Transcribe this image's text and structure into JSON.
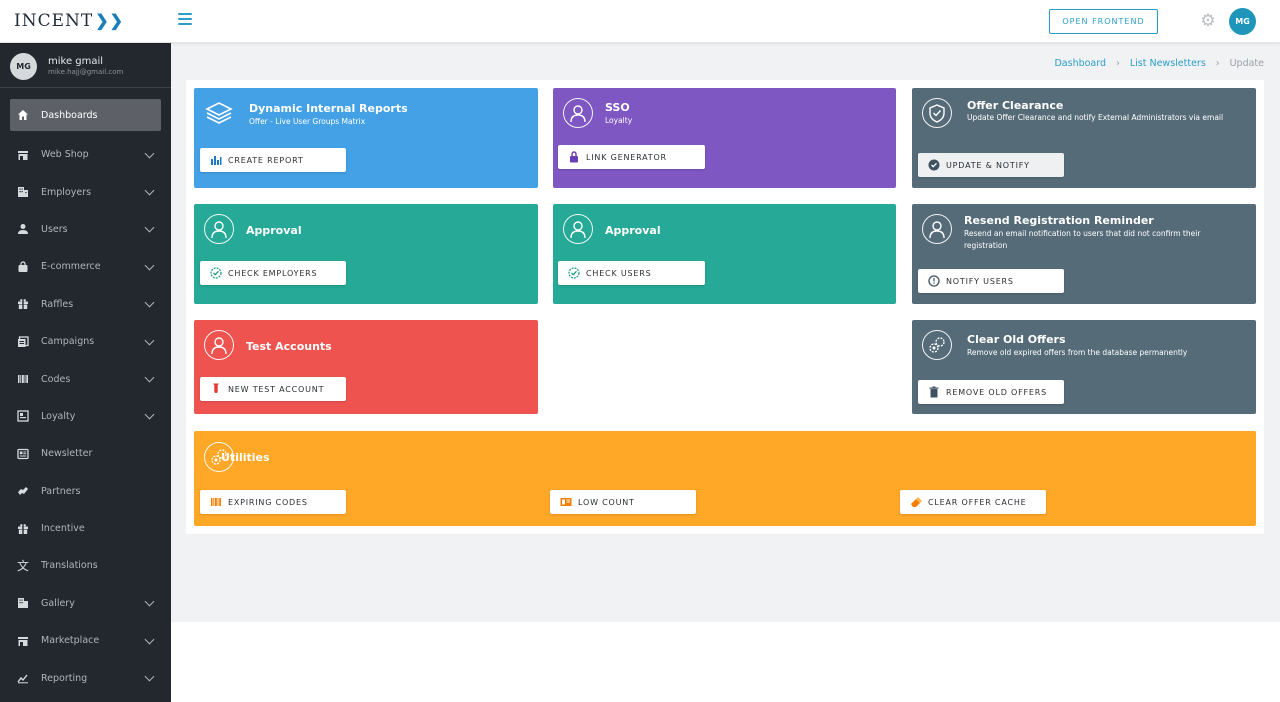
{
  "app": {
    "logo_text": "INCENT",
    "logo_mark": "❯❯"
  },
  "topbar": {
    "open_frontend_label": "OPEN FRONTEND",
    "avatar_initials": "MG"
  },
  "user": {
    "initials": "MG",
    "name": "mike gmail",
    "email": "mike.hajj@gmail.com"
  },
  "sidebar": {
    "items": [
      {
        "label": "Dashboards",
        "icon": "home-icon",
        "active": true,
        "expandable": false
      },
      {
        "label": "Web Shop",
        "icon": "store-icon",
        "expandable": true
      },
      {
        "label": "Employers",
        "icon": "building-icon",
        "expandable": true
      },
      {
        "label": "Users",
        "icon": "person-icon",
        "expandable": true
      },
      {
        "label": "E-commerce",
        "icon": "shopping-bag-icon",
        "expandable": true
      },
      {
        "label": "Raffles",
        "icon": "gift-icon",
        "expandable": true
      },
      {
        "label": "Campaigns",
        "icon": "campaign-icon",
        "expandable": true
      },
      {
        "label": "Codes",
        "icon": "barcode-icon",
        "expandable": true
      },
      {
        "label": "Loyalty",
        "icon": "loyalty-icon",
        "expandable": true
      },
      {
        "label": "Newsletter",
        "icon": "newsletter-icon",
        "expandable": false
      },
      {
        "label": "Partners",
        "icon": "handshake-icon",
        "expandable": false
      },
      {
        "label": "Incentive",
        "icon": "gift-icon",
        "expandable": false
      },
      {
        "label": "Translations",
        "icon": "translate-icon",
        "expandable": false
      },
      {
        "label": "Gallery",
        "icon": "building-icon",
        "expandable": true
      },
      {
        "label": "Marketplace",
        "icon": "store-icon",
        "expandable": true
      },
      {
        "label": "Reporting",
        "icon": "chart-icon",
        "expandable": true
      }
    ]
  },
  "breadcrumb": {
    "items": [
      "Dashboard",
      "List Newsletters",
      "Update"
    ],
    "separator": "›"
  },
  "cards": {
    "reports": {
      "title": "Dynamic Internal Reports",
      "subtitle": "Offer - Live User Groups Matrix",
      "button": "CREATE REPORT"
    },
    "sso": {
      "title": "SSO",
      "subtitle": "Loyalty",
      "button": "LINK GENERATOR"
    },
    "offer_clearance": {
      "title": "Offer Clearance",
      "subtitle": "Update Offer Clearance and notify External Administrators via email",
      "button": "UPDATE & NOTIFY"
    },
    "approval_employers": {
      "title": "Approval",
      "button": "CHECK EMPLOYERS"
    },
    "approval_users": {
      "title": "Approval",
      "button": "CHECK USERS"
    },
    "resend": {
      "title": "Resend Registration Reminder",
      "subtitle": "Resend an email notification to users that did not confirm their registration",
      "button": "NOTIFY USERS"
    },
    "test_accounts": {
      "title": "Test Accounts",
      "button": "NEW TEST ACCOUNT"
    },
    "clear_offers": {
      "title": "Clear Old Offers",
      "subtitle": "Remove old expired offers from the database permanently",
      "button": "REMOVE OLD OFFERS"
    },
    "utilities": {
      "title": "Utilities",
      "buttons": [
        "EXPIRING CODES",
        "LOW COUNT",
        "CLEAR OFFER CACHE"
      ]
    }
  },
  "colors": {
    "accent": "#2a9ec7",
    "blue": "#44a1e6",
    "purple": "#7f57c2",
    "slate": "#566b78",
    "teal": "#26a996",
    "red": "#ef5350",
    "orange": "#ffa726",
    "sidebar": "#23282e"
  }
}
